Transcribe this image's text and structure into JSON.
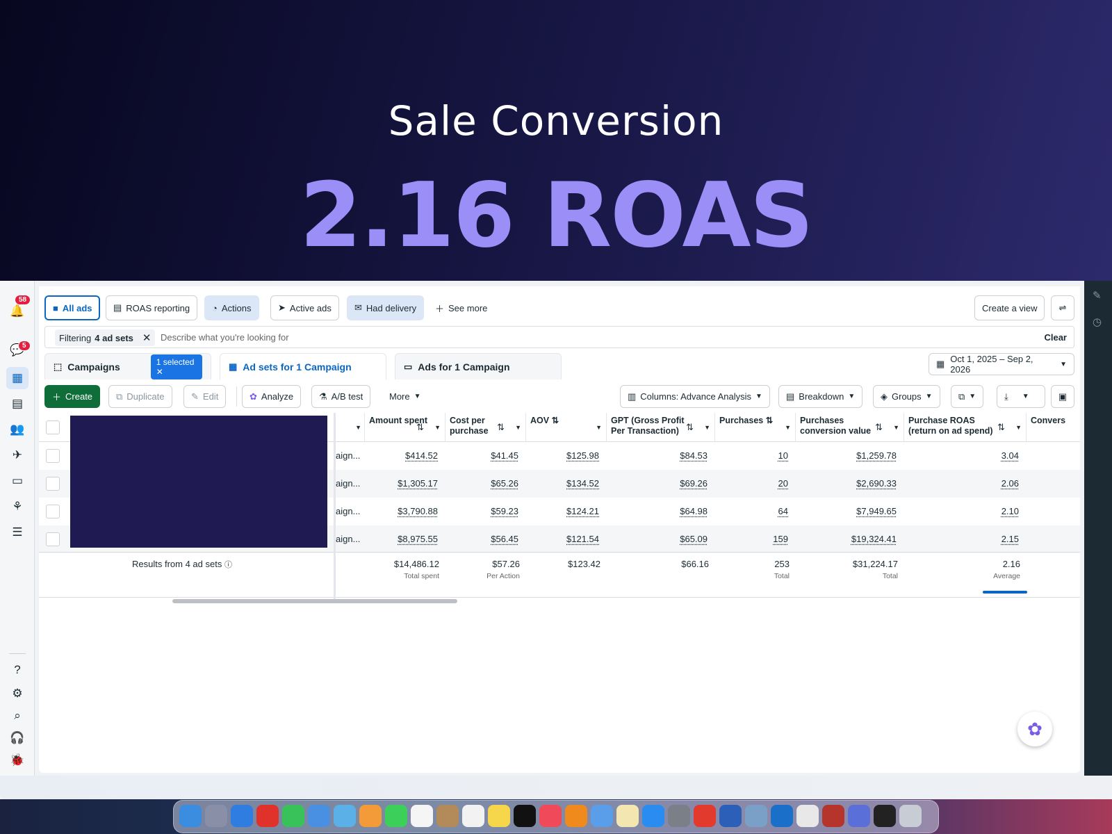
{
  "hero": {
    "subtitle": "Sale Conversion",
    "title": "2.16 ROAS"
  },
  "leftnav": {
    "notif_badge": "58",
    "msg_badge": "5",
    "help": "?"
  },
  "views": [
    {
      "label": "All ads",
      "icon": "folder-icon"
    },
    {
      "label": "ROAS reporting",
      "icon": "report-icon"
    },
    {
      "label": "Actions",
      "icon": "actions-icon"
    },
    {
      "label": "Active ads",
      "icon": "send-icon"
    },
    {
      "label": "Had delivery",
      "icon": "delivery-icon"
    },
    {
      "label": "See more",
      "icon": "plus-icon"
    }
  ],
  "create_view": "Create a view",
  "filter": {
    "prefix": "Filtering",
    "bold": "4 ad sets",
    "placeholder": "Describe what you're looking for",
    "clear": "Clear"
  },
  "tabs": {
    "campaigns": "Campaigns",
    "selected": "1 selected",
    "adsets": "Ad sets for 1 Campaign",
    "ads": "Ads for 1 Campaign"
  },
  "date_range": "Oct 1, 2025 – Sep 2, 2026",
  "toolbar": {
    "create": "Create",
    "duplicate": "Duplicate",
    "edit": "Edit",
    "analyze": "Analyze",
    "abtest": "A/B test",
    "more": "More",
    "columns": "Columns: Advance Analysis",
    "breakdown": "Breakdown",
    "groups": "Groups"
  },
  "columns": [
    {
      "label": "Amount spent"
    },
    {
      "label": "Cost per purchase"
    },
    {
      "label": "AOV"
    },
    {
      "label": "GPT (Gross Profit Per Transaction)"
    },
    {
      "label": "Purchases"
    },
    {
      "label": "Purchases conversion value"
    },
    {
      "label": "Purchase ROAS (return on ad spend)"
    },
    {
      "label": "Convers"
    }
  ],
  "campaign_truncated": "aign...",
  "rows": [
    [
      "$414.52",
      "$41.45",
      "$125.98",
      "$84.53",
      "10",
      "$1,259.78",
      "3.04"
    ],
    [
      "$1,305.17",
      "$65.26",
      "$134.52",
      "$69.26",
      "20",
      "$2,690.33",
      "2.06"
    ],
    [
      "$3,790.88",
      "$59.23",
      "$124.21",
      "$64.98",
      "64",
      "$7,949.65",
      "2.10"
    ],
    [
      "$8,975.55",
      "$56.45",
      "$121.54",
      "$65.09",
      "159",
      "$19,324.41",
      "2.15"
    ]
  ],
  "results_label": "Results from 4 ad sets",
  "totals": [
    {
      "value": "$14,486.12",
      "sub": "Total spent"
    },
    {
      "value": "$57.26",
      "sub": "Per Action"
    },
    {
      "value": "$123.42",
      "sub": ""
    },
    {
      "value": "$66.16",
      "sub": ""
    },
    {
      "value": "253",
      "sub": "Total"
    },
    {
      "value": "$31,224.17",
      "sub": "Total"
    },
    {
      "value": "2.16",
      "sub": "Average"
    }
  ]
}
